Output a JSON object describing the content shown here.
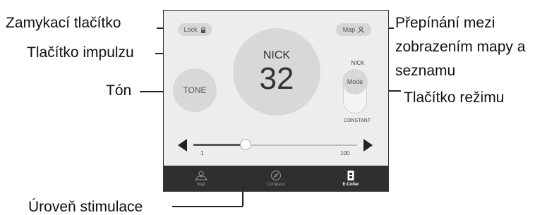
{
  "callouts": {
    "lock": "Zamykací tlačítko",
    "impulse": "Tlačítko impulzu",
    "tone": "Tón",
    "map_switch_line1": "Přepínání mezi",
    "map_switch_line2": "zobrazením mapy a",
    "map_switch_line3": "seznamu",
    "mode": "Tlačítko režimu",
    "stimulation": "Úroveň stimulace"
  },
  "app": {
    "lock_label": "Lock",
    "map_label": "Map",
    "impulse_label": "NICK",
    "level": "32",
    "tone_label": "TONE",
    "mode_label": "Mode",
    "mode_top": "NICK",
    "mode_bottom": "CONSTANT",
    "slider_min": "1",
    "slider_max": "100",
    "slider_value_fraction": 0.32,
    "nav": [
      {
        "label": "Map",
        "icon": "map-icon"
      },
      {
        "label": "Compass",
        "icon": "compass-icon"
      },
      {
        "label": "E-Collar",
        "icon": "e-collar-icon",
        "active": true
      }
    ]
  }
}
